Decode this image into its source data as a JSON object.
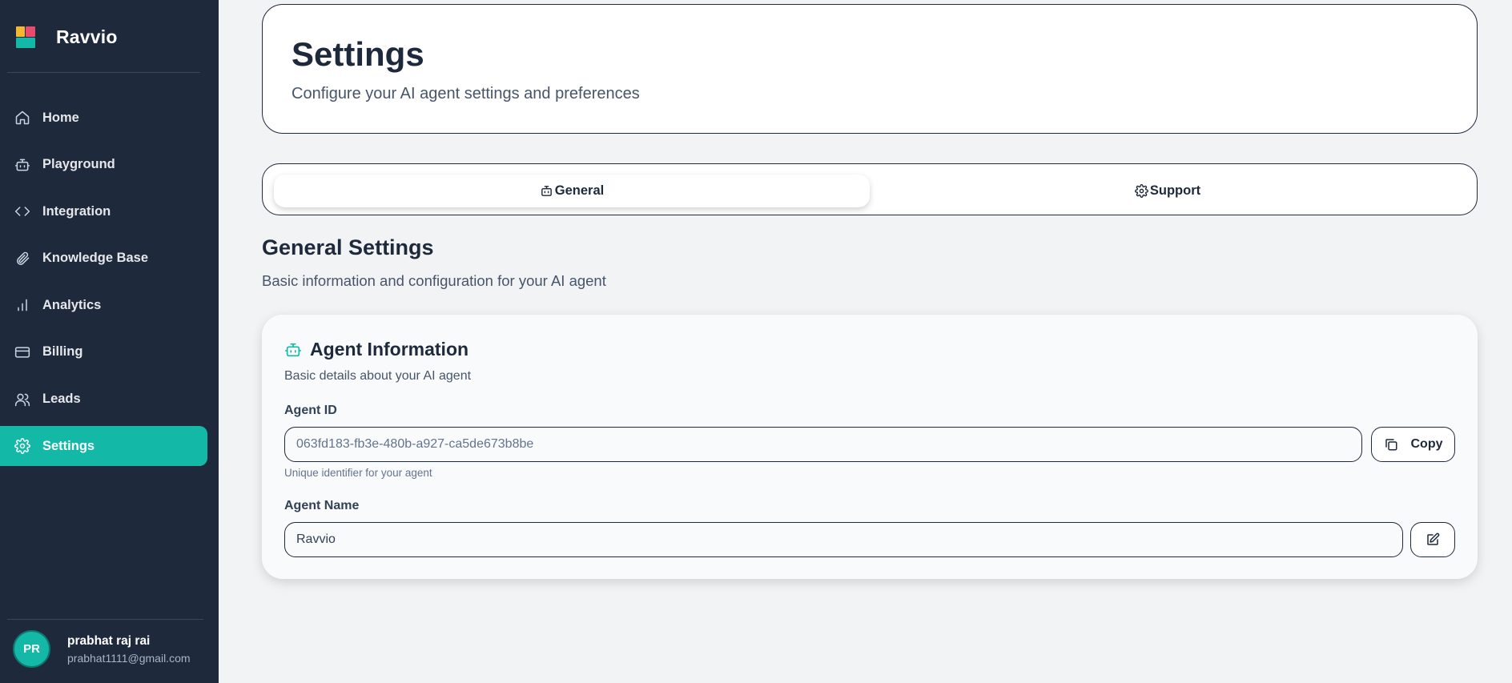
{
  "app": {
    "name": "Ravvio"
  },
  "sidebar": {
    "items": [
      {
        "label": "Home",
        "icon": "home-icon"
      },
      {
        "label": "Playground",
        "icon": "bot-icon"
      },
      {
        "label": "Integration",
        "icon": "code-icon"
      },
      {
        "label": "Knowledge Base",
        "icon": "paperclip-icon"
      },
      {
        "label": "Analytics",
        "icon": "bar-chart-icon"
      },
      {
        "label": "Billing",
        "icon": "credit-card-icon"
      },
      {
        "label": "Leads",
        "icon": "users-icon"
      },
      {
        "label": "Settings",
        "icon": "gear-icon",
        "active": true
      }
    ]
  },
  "user": {
    "initials": "PR",
    "name": "prabhat raj rai",
    "email": "prabhat1111@gmail.com"
  },
  "header": {
    "title": "Settings",
    "subtitle": "Configure your AI agent settings and preferences"
  },
  "tabs": [
    {
      "label": "General",
      "icon": "bot-icon",
      "selected": true
    },
    {
      "label": "Support",
      "icon": "gear-icon",
      "selected": false
    }
  ],
  "section": {
    "title": "General Settings",
    "subtitle": "Basic information and configuration for your AI agent"
  },
  "agent_card": {
    "title": "Agent Information",
    "description": "Basic details about your AI agent",
    "agent_id": {
      "label": "Agent ID",
      "value": "063fd183-fb3e-480b-a927-ca5de673b8be",
      "helper": "Unique identifier for your agent",
      "copy_label": "Copy"
    },
    "agent_name": {
      "label": "Agent Name",
      "value": "Ravvio"
    }
  },
  "colors": {
    "sidebar_bg": "#1e293b",
    "accent": "#14b8a6",
    "page_bg": "#f2f3f5"
  }
}
